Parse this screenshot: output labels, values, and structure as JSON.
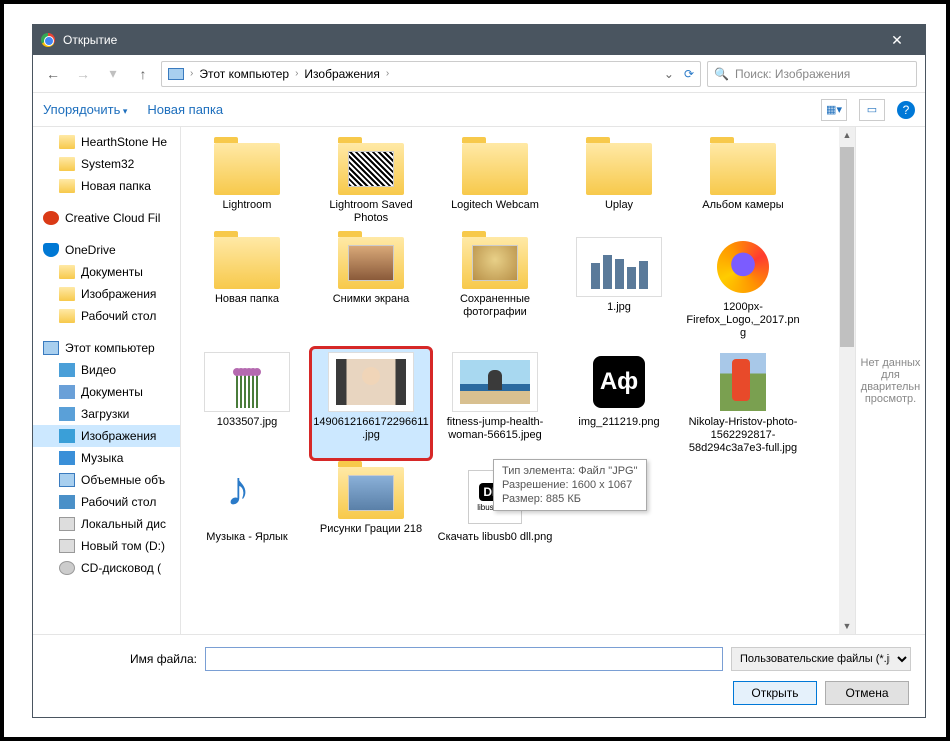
{
  "titlebar": {
    "title": "Открытие",
    "close": "✕"
  },
  "nav": {
    "back": "←",
    "fwd": "→",
    "up": "↑",
    "path_root": "Этот компьютер",
    "path_sub": "Изображения",
    "sep": "›",
    "refresh": "⟳",
    "search_placeholder": "Поиск: Изображения",
    "search_icon": "🔍"
  },
  "toolbar": {
    "organize": "Упорядочить",
    "newfolder": "Новая папка",
    "view_dd": "▾",
    "help": "?"
  },
  "tree": {
    "hearthstone": "HearthStone  He",
    "system32": "System32",
    "newfolder": "Новая папка",
    "cc": "Creative Cloud Fil",
    "onedrive": "OneDrive",
    "od_docs": "Документы",
    "od_pics": "Изображения",
    "od_desk": "Рабочий стол",
    "pc": "Этот компьютер",
    "video": "Видео",
    "docs": "Документы",
    "downloads": "Загрузки",
    "pics": "Изображения",
    "music": "Музыка",
    "volumes": "Объемные объ",
    "desk": "Рабочий стол",
    "local": "Локальный дис",
    "newvol": "Новый том (D:)",
    "cddrive": "CD-дисковод ("
  },
  "items": {
    "lightroom": "Lightroom",
    "lr_saved": "Lightroom Saved Photos",
    "logitech": "Logitech Webcam",
    "uplay": "Uplay",
    "camera": "Альбом камеры",
    "newfolder": "Новая папка",
    "screenshots": "Снимки экрана",
    "saved_photos": "Сохраненные фотографии",
    "one_jpg": "1.jpg",
    "firefox": "1200px-Firefox_Logo,_2017.png",
    "flowers": "1033507.jpg",
    "portrait": "1490612166172296611.jpg",
    "fitness": "fitness-jump-health-woman-56615.jpeg",
    "af": "img_211219.png",
    "nikolay": "Nikolay-Hristov-photo-1562292817-58d294c3a7e3-full.jpg",
    "music_shortcut": "Музыка - Ярлык",
    "risunki": "Рисунки Грации 218",
    "libusb": "Скачать libusb0 dll.png"
  },
  "tooltip": {
    "l1": "Тип элемента: Файл \"JPG\"",
    "l2": "Разрешение: 1600 x 1067",
    "l3": "Размер: 885 КБ"
  },
  "preview": {
    "msg": "Нет данных для дварительн просмотр."
  },
  "bottom": {
    "filename_label": "Имя файла:",
    "filename_value": "",
    "filter": "Пользовательские файлы (*.jr",
    "open": "Открыть",
    "cancel": "Отмена"
  },
  "af_text": "Аф",
  "dll_text": "DLL",
  "dll_sub": "libusb0.dll"
}
